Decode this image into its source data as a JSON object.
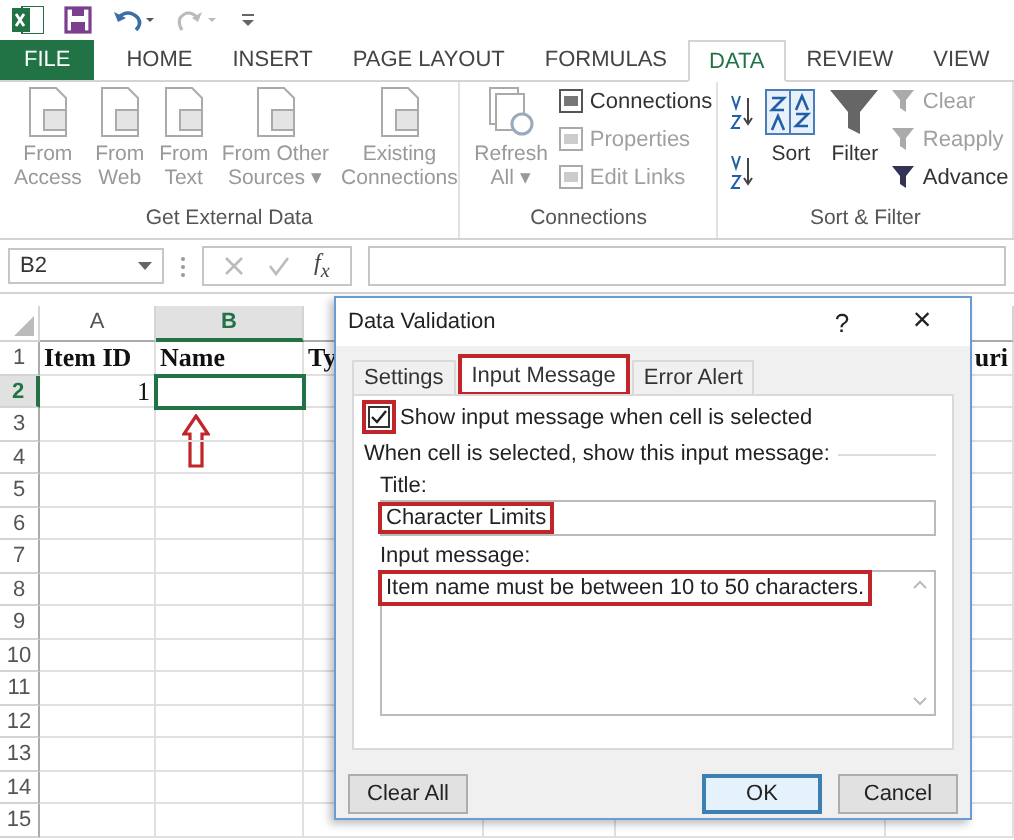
{
  "tabs": [
    {
      "label": "FILE",
      "kind": "file",
      "selected": false
    },
    {
      "label": "HOME",
      "kind": "tab",
      "selected": false
    },
    {
      "label": "INSERT",
      "kind": "tab",
      "selected": false
    },
    {
      "label": "PAGE LAYOUT",
      "kind": "tab",
      "selected": false
    },
    {
      "label": "FORMULAS",
      "kind": "tab",
      "selected": false
    },
    {
      "label": "DATA",
      "kind": "tab",
      "selected": true
    },
    {
      "label": "REVIEW",
      "kind": "tab",
      "selected": false
    },
    {
      "label": "VIEW",
      "kind": "tab",
      "selected": false
    }
  ],
  "ribbon": {
    "groups": [
      {
        "label": "Get External Data",
        "buttons": [
          {
            "kind": "large",
            "lines": [
              "From",
              "Access"
            ],
            "disabled": true
          },
          {
            "kind": "large",
            "lines": [
              "From",
              "Web"
            ],
            "disabled": true
          },
          {
            "kind": "large",
            "lines": [
              "From",
              "Text"
            ],
            "disabled": true
          },
          {
            "kind": "large",
            "lines": [
              "From Other",
              "Sources ▾"
            ],
            "disabled": true
          },
          {
            "kind": "large",
            "lines": [
              "Existing",
              "Connections"
            ],
            "disabled": true
          }
        ]
      },
      {
        "label": "Connections",
        "buttons": [
          {
            "kind": "large",
            "lines": [
              "Refresh",
              "All ▾"
            ],
            "disabled": true
          },
          {
            "kind": "small",
            "lines": [
              "Connections"
            ],
            "disabled": false
          },
          {
            "kind": "small",
            "lines": [
              "Properties"
            ],
            "disabled": true
          },
          {
            "kind": "small",
            "lines": [
              "Edit Links"
            ],
            "disabled": true
          }
        ]
      },
      {
        "label": "Sort & Filter",
        "buttons": [
          {
            "kind": "tiny",
            "disabled": false
          },
          {
            "kind": "tiny",
            "disabled": false
          },
          {
            "kind": "large",
            "lines": [
              "Sort"
            ],
            "disabled": false
          },
          {
            "kind": "large",
            "lines": [
              "Filter"
            ],
            "disabled": false
          },
          {
            "kind": "small",
            "lines": [
              "Clear"
            ],
            "disabled": true
          },
          {
            "kind": "small",
            "lines": [
              "Reapply"
            ],
            "disabled": true
          },
          {
            "kind": "small",
            "lines": [
              "Advance"
            ],
            "disabled": false
          }
        ]
      }
    ]
  },
  "formula_bar": {
    "name_box": "B2",
    "function_label": "f$_{x}$"
  },
  "sheet": {
    "columns": [
      {
        "label": "A",
        "selected": false
      },
      {
        "label": "B",
        "selected": true
      }
    ],
    "rows": [
      {
        "number": "1",
        "selected": false,
        "cells": {
          "A": "Item ID",
          "B": "Name",
          "column_3": "Ty",
          "column_6": "uri"
        }
      },
      {
        "number": "2",
        "selected": true,
        "cells": {
          "A": "1"
        }
      },
      {
        "number": "3",
        "selected": false,
        "cells": {}
      },
      {
        "number": "4",
        "selected": false,
        "cells": {}
      },
      {
        "number": "5",
        "selected": false,
        "cells": {}
      },
      {
        "number": "6",
        "selected": false,
        "cells": {}
      },
      {
        "number": "7",
        "selected": false,
        "cells": {}
      },
      {
        "number": "8",
        "selected": false,
        "cells": {}
      },
      {
        "number": "9",
        "selected": false,
        "cells": {}
      },
      {
        "number": "10",
        "selected": false,
        "cells": {}
      },
      {
        "number": "11",
        "selected": false,
        "cells": {}
      },
      {
        "number": "12",
        "selected": false,
        "cells": {}
      },
      {
        "number": "13",
        "selected": false,
        "cells": {}
      },
      {
        "number": "14",
        "selected": false,
        "cells": {}
      },
      {
        "number": "15",
        "selected": false,
        "cells": {}
      }
    ]
  },
  "dialog": {
    "title": "Data Validation",
    "help": "?",
    "close": "×",
    "tabs": [
      {
        "label": "Settings",
        "selected": false,
        "highlighted": false
      },
      {
        "label": "Input Message",
        "selected": true,
        "highlighted": true
      },
      {
        "label": "Error Alert",
        "selected": false,
        "highlighted": false
      }
    ],
    "checkbox": {
      "label": "Show input message when cell is selected",
      "checked": true,
      "highlighted": true
    },
    "section": "When cell is selected, show this input message:",
    "title_label": "Title:",
    "title_value": "Character Limits",
    "title_highlighted": true,
    "message_label": "Input message:",
    "message_value": "Item name must be between 10 to 50 characters.",
    "message_highlighted": true,
    "buttons": [
      {
        "label": "Clear All",
        "kind": "left",
        "default": false
      },
      {
        "label": "OK",
        "kind": "right",
        "default": true
      },
      {
        "label": "Cancel",
        "kind": "right",
        "default": false
      }
    ]
  }
}
